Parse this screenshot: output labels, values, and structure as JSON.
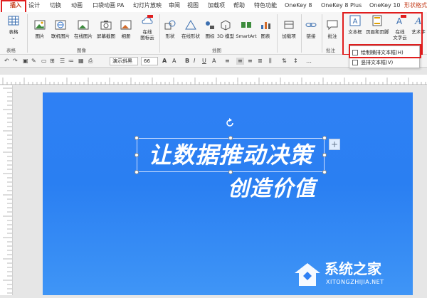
{
  "tabs": [
    {
      "label": "插入",
      "active": true
    },
    {
      "label": "设计",
      "active": false
    },
    {
      "label": "切换",
      "active": false
    },
    {
      "label": "动画",
      "active": false
    },
    {
      "label": "口袋动画 PA",
      "active": false
    },
    {
      "label": "幻灯片放映",
      "active": false
    },
    {
      "label": "审阅",
      "active": false
    },
    {
      "label": "视图",
      "active": false
    },
    {
      "label": "加载项",
      "active": false
    },
    {
      "label": "帮助",
      "active": false
    },
    {
      "label": "特色功能",
      "active": false
    },
    {
      "label": "OneKey 8",
      "active": false
    },
    {
      "label": "OneKey 8 Plus",
      "active": false
    },
    {
      "label": "OneKey 10",
      "active": false
    },
    {
      "label": "形状格式",
      "active": false
    }
  ],
  "ribbon": {
    "buttons": {
      "table": "表格",
      "picture": "图片",
      "online_picture": "联机图片",
      "online_picture2": "在线图片",
      "screenshot": "屏幕截图",
      "album": "相册",
      "online_icon_cloud_1": "在线",
      "online_icon_cloud_2": "图标云",
      "shapes": "形状",
      "online_shapes": "在线形状",
      "icons": "图标",
      "model3d": "3D 模型",
      "smartart": "SmartArt",
      "chart": "图表",
      "addins": "加载项",
      "link": "链接",
      "comment": "批注",
      "textbox": "文本框",
      "header_footer": "页眉和页脚",
      "online_text_cloud_1": "在线",
      "online_text_cloud_2": "文字云",
      "wordart": "艺术字"
    },
    "groups": {
      "tables": "表格",
      "images": "图像",
      "illustrations": "插图",
      "comments": "批注"
    }
  },
  "format_bar": {
    "font_name": "演示斜黑",
    "font_size": "66"
  },
  "dropdown": {
    "items": [
      "绘制横排文本框(H)",
      "竖排文本框(V)"
    ]
  },
  "slide": {
    "title_line1": "让数据推动决策",
    "title_line2": "创造价值"
  },
  "watermark": {
    "name": "系统之家",
    "url": "XITONGZHIJIA.NET"
  },
  "colors": {
    "active_tab": "#c43e1c",
    "highlight_red": "#e01e1e",
    "slide_blue": "#2f80f4"
  }
}
